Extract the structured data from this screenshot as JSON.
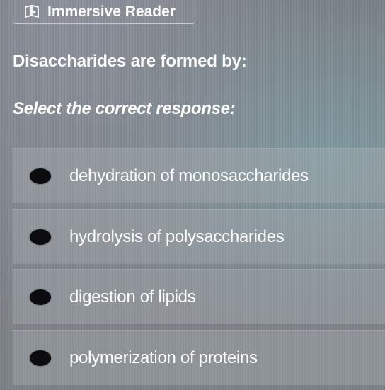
{
  "toolbar": {
    "immersive_reader_label": "Immersive Reader",
    "immersive_reader_icon": "immersive-reader-icon"
  },
  "question": {
    "text": "Disaccharides are formed by:",
    "instruction": "Select the correct response:"
  },
  "options": [
    {
      "label": "dehydration of monosaccharides",
      "selected": false
    },
    {
      "label": "hydrolysis of polysaccharides",
      "selected": false
    },
    {
      "label": "digestion of lipids",
      "selected": false
    },
    {
      "label": "polymerization of proteins",
      "selected": false
    }
  ],
  "colors": {
    "text": "#ffffff",
    "radio": "#0c0c0e"
  }
}
